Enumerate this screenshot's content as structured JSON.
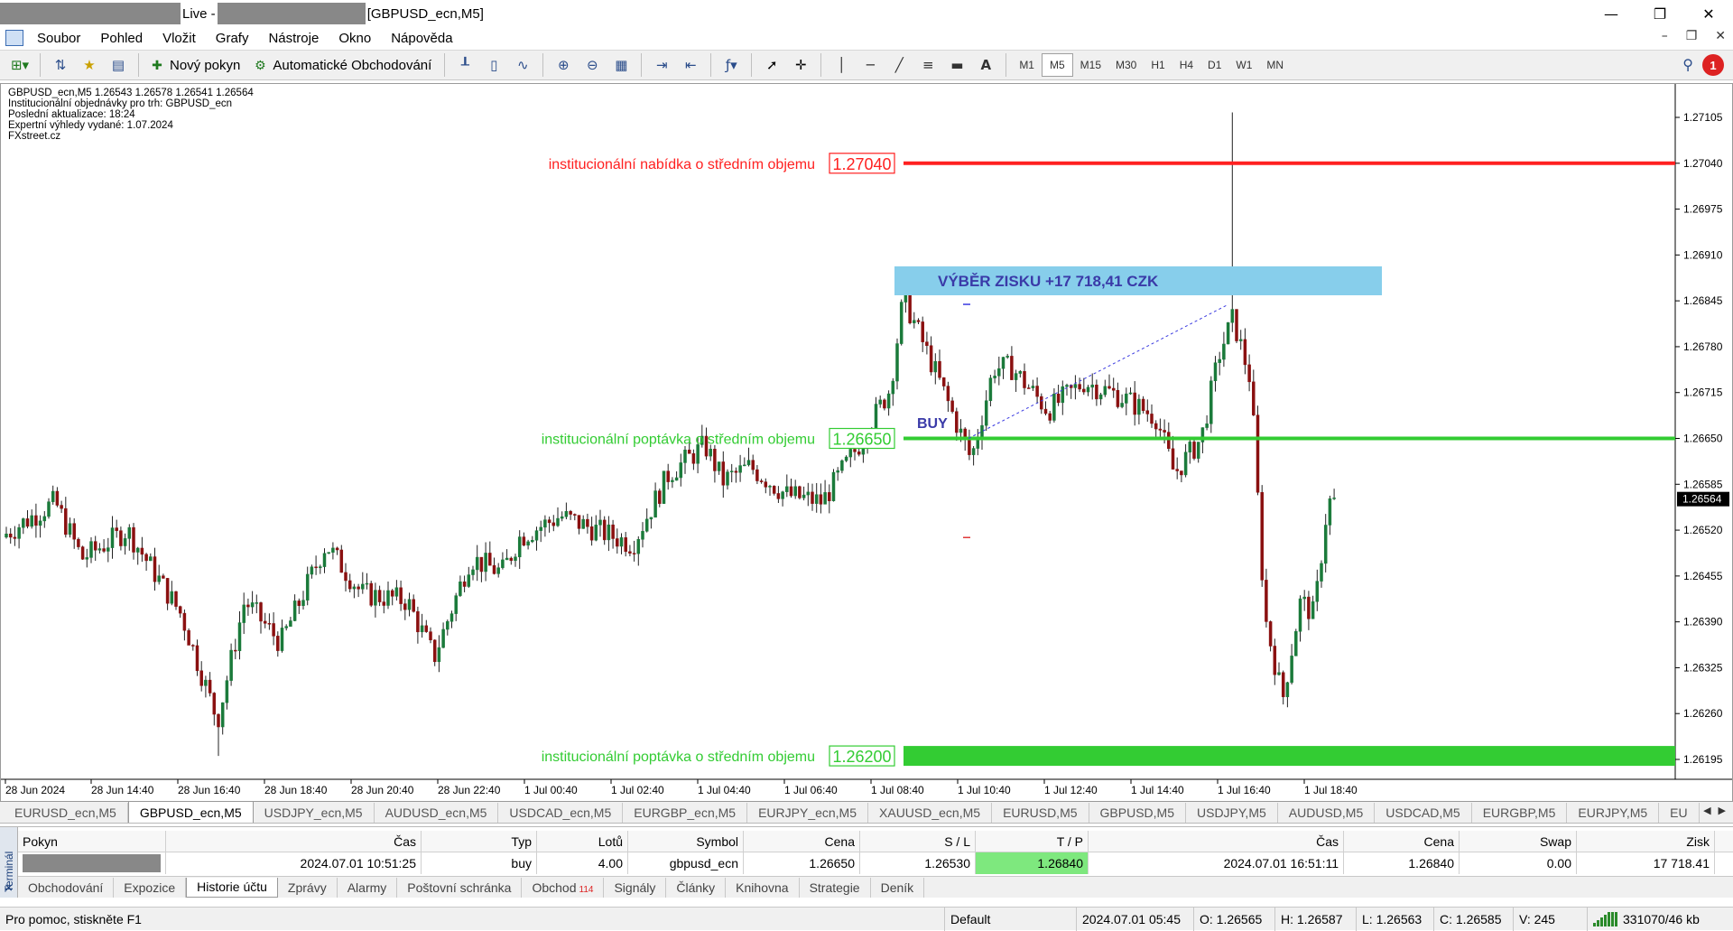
{
  "window": {
    "title_live": "Live - ",
    "title_chart": "[GBPUSD_ecn,M5]",
    "controls": [
      "—",
      "❐",
      "✕"
    ]
  },
  "menu": [
    "Soubor",
    "Pohled",
    "Vložit",
    "Grafy",
    "Nástroje",
    "Okno",
    "Nápověda"
  ],
  "toolbar": {
    "new_order": "Nový pokyn",
    "auto_trading": "Automatické Obchodování",
    "timeframes": [
      "M1",
      "M5",
      "M15",
      "M30",
      "H1",
      "H4",
      "D1",
      "W1",
      "MN"
    ],
    "active_timeframe": "M5",
    "text_tool": "A",
    "notification_count": "1"
  },
  "chart_info": [
    "GBPUSD_ecn,M5  1.26543 1.26578 1.26541 1.26564",
    "Institucionální objednávky pro trh: GBPUSD_ecn",
    "Poslední aktualizace: 18:24",
    "Expertní výhledy vydané: 1.07.2024",
    "FXstreet.cz"
  ],
  "chart_data": {
    "type": "candlestick",
    "symbol": "GBPUSD_ecn",
    "timeframe": "M5",
    "ylim": [
      1.2616,
      1.2714
    ],
    "y_ticks": [
      "1.27105",
      "1.27040",
      "1.26975",
      "1.26910",
      "1.26845",
      "1.26780",
      "1.26715",
      "1.26650",
      "1.26585",
      "1.26520",
      "1.26455",
      "1.26390",
      "1.26325",
      "1.26260",
      "1.26195"
    ],
    "x_ticks": [
      "28 Jun 2024",
      "28 Jun 14:40",
      "28 Jun 16:40",
      "28 Jun 18:40",
      "28 Jun 20:40",
      "28 Jun 22:40",
      "1 Jul 00:40",
      "1 Jul 02:40",
      "1 Jul 04:40",
      "1 Jul 06:40",
      "1 Jul 08:40",
      "1 Jul 10:40",
      "1 Jul 12:40",
      "1 Jul 14:40",
      "1 Jul 16:40",
      "1 Jul 18:40"
    ],
    "current_price": "1.26564",
    "levels": [
      {
        "label": "institucionální nabídka o středním objemu",
        "price": 1.2704,
        "price_text": "1.27040",
        "color": "#ff2020",
        "kind": "line"
      },
      {
        "label": "institucionální poptávka o středním objemu",
        "price": 1.2665,
        "price_text": "1.26650",
        "color": "#33cc33",
        "kind": "line"
      },
      {
        "label": "institucionální poptávka o středním objemu",
        "price": 1.262,
        "price_text": "1.26200",
        "color": "#33cc33",
        "kind": "zone"
      }
    ],
    "annotations": {
      "profit_box": "VÝBĚR ZISKU +17 718,41 CZK",
      "buy_label": "BUY"
    },
    "colors": {
      "bull": "#1a7a3a",
      "bear": "#8a1010",
      "profit_box": "#87ceeb",
      "text_blue": "#3a3aa8"
    }
  },
  "symbol_tabs": [
    "EURUSD_ecn,M5",
    "GBPUSD_ecn,M5",
    "USDJPY_ecn,M5",
    "AUDUSD_ecn,M5",
    "USDCAD_ecn,M5",
    "EURGBP_ecn,M5",
    "EURJPY_ecn,M5",
    "XAUUSD_ecn,M5",
    "EURUSD,M5",
    "GBPUSD,M5",
    "USDJPY,M5",
    "AUDUSD,M5",
    "USDCAD,M5",
    "EURGBP,M5",
    "EURJPY,M5",
    "EU"
  ],
  "active_symbol_tab": "GBPUSD_ecn,M5",
  "terminal": {
    "side_label": "Terminál",
    "columns": [
      "Pokyn",
      "Čas",
      "Typ",
      "Lotů",
      "Symbol",
      "Cena",
      "S / L",
      "T / P",
      "Čas",
      "Cena",
      "Swap",
      "Zisk"
    ],
    "row": {
      "pokyn": "",
      "cas": "2024.07.01 10:51:25",
      "typ": "buy",
      "lotu": "4.00",
      "symbol": "gbpusd_ecn",
      "cena": "1.26650",
      "sl": "1.26530",
      "tp": "1.26840",
      "cas2": "2024.07.01 16:51:11",
      "cena2": "1.26840",
      "swap": "0.00",
      "zisk": "17 718.41"
    },
    "tabs": [
      "Obchodování",
      "Expozice",
      "Historie účtu",
      "Zprávy",
      "Alarmy",
      "Poštovní schránka",
      "Obchod",
      "Signály",
      "Články",
      "Knihovna",
      "Strategie",
      "Deník"
    ],
    "active_tab": "Historie účtu",
    "obchod_badge": "114"
  },
  "status": {
    "help": "Pro pomoc, stiskněte F1",
    "profile": "Default",
    "datetime": "2024.07.01 05:45",
    "open": "O: 1.26565",
    "high": "H: 1.26587",
    "low": "L: 1.26563",
    "close": "C: 1.26585",
    "volume": "V: 245",
    "connection": "331070/46 kb"
  }
}
